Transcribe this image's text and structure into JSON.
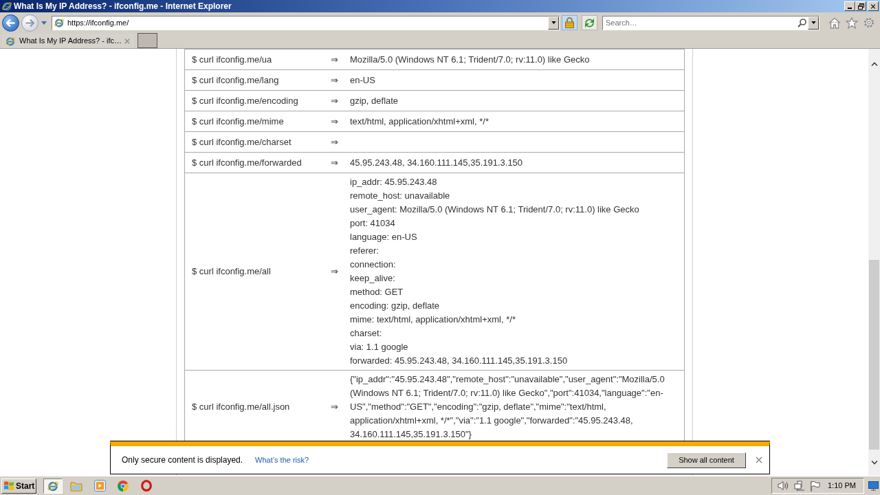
{
  "window": {
    "title": "What Is My IP Address? - ifconfig.me - Internet Explorer"
  },
  "address_bar": {
    "url": "https://ifconfig.me/",
    "secure": true
  },
  "search": {
    "placeholder": "Search…"
  },
  "tabs": [
    {
      "label": "What Is My IP Address? - ifc…",
      "selected": true
    }
  ],
  "table": {
    "rows": [
      {
        "command": "$ curl ifconfig.me/ua",
        "arrow": "⇒",
        "value": "Mozilla/5.0 (Windows NT 6.1; Trident/7.0; rv:11.0) like Gecko"
      },
      {
        "command": "$ curl ifconfig.me/lang",
        "arrow": "⇒",
        "value": "en-US"
      },
      {
        "command": "$ curl ifconfig.me/encoding",
        "arrow": "⇒",
        "value": "gzip, deflate"
      },
      {
        "command": "$ curl ifconfig.me/mime",
        "arrow": "⇒",
        "value": "text/html, application/xhtml+xml, */*"
      },
      {
        "command": "$ curl ifconfig.me/charset",
        "arrow": "⇒"
      },
      {
        "command": "$ curl ifconfig.me/forwarded",
        "arrow": "⇒",
        "value": "45.95.243.48, 34.160.111.145,35.191.3.150"
      },
      {
        "command": "$ curl ifconfig.me/all",
        "arrow": "⇒",
        "lines": [
          "ip_addr: 45.95.243.48",
          "remote_host: unavailable",
          "user_agent: Mozilla/5.0 (Windows NT 6.1; Trident/7.0; rv:11.0) like Gecko",
          "port: 41034",
          "language: en-US",
          "referer:",
          "connection:",
          "keep_alive:",
          "method: GET",
          "encoding: gzip, deflate",
          "mime: text/html, application/xhtml+xml, */*",
          "charset:",
          "via: 1.1 google",
          "forwarded: 45.95.243.48, 34.160.111.145,35.191.3.150"
        ]
      },
      {
        "command": "$ curl ifconfig.me/all.json",
        "arrow": "⇒",
        "value": "{\"ip_addr\":\"45.95.243.48\",\"remote_host\":\"unavailable\",\"user_agent\":\"Mozilla/5.0 (Windows NT 6.1; Trident/7.0; rv:11.0) like Gecko\",\"port\":41034,\"language\":\"en-US\",\"method\":\"GET\",\"encoding\":\"gzip, deflate\",\"mime\":\"text/html, application/xhtml+xml, */*\",\"via\":\"1.1 google\",\"forwarded\":\"45.95.243.48, 34.160.111.145,35.191.3.150\"}"
      }
    ]
  },
  "notification": {
    "message": "Only secure content is displayed.",
    "link": "What’s the risk?",
    "button": "Show all content"
  },
  "taskbar": {
    "start": "Start",
    "apps": [
      {
        "selected": true
      },
      {
        "selected": false
      },
      {
        "selected": false
      },
      {
        "selected": false
      },
      {
        "selected": false
      }
    ],
    "clock": "1:10 PM"
  }
}
